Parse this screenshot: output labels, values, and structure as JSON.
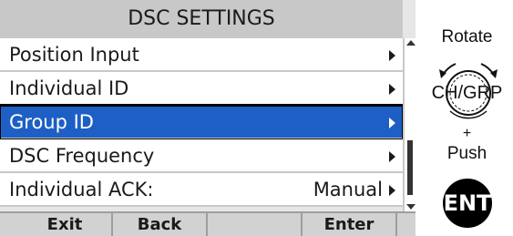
{
  "screen": {
    "title": "DSC SETTINGS",
    "menu_items": [
      {
        "label": "Position Input",
        "value": "",
        "selected": false
      },
      {
        "label": "Individual ID",
        "value": "",
        "selected": false
      },
      {
        "label": "Group ID",
        "value": "",
        "selected": true
      },
      {
        "label": "DSC Frequency",
        "value": "",
        "selected": false
      },
      {
        "label": "Individual ACK:",
        "value": "Manual",
        "selected": false
      }
    ],
    "softkeys": [
      "Exit",
      "Back",
      "",
      "Enter"
    ]
  },
  "instructions": {
    "rotate": "Rotate",
    "dial_label": "CH/GRP",
    "plus": "+",
    "push": "Push",
    "button_label": "ENT"
  },
  "colors": {
    "selected_bg": "#1d5fc4",
    "title_bg": "#c8c8c8",
    "softkey_bg": "#d2d2d2"
  },
  "icons": [
    "submenu-arrow-icon",
    "scroll-up-icon",
    "scroll-down-icon",
    "rotate-knob-icon",
    "ent-button-icon"
  ]
}
